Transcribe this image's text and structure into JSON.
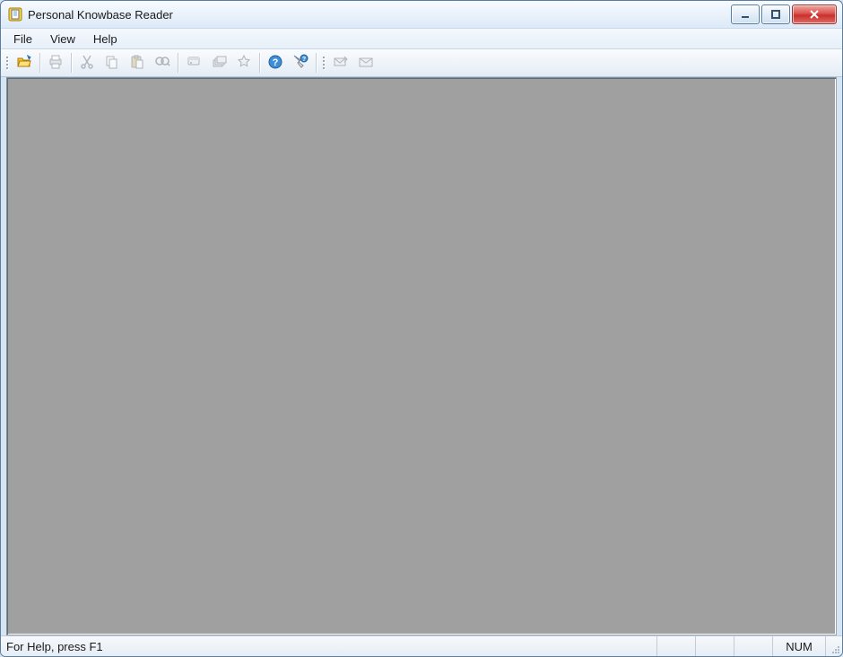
{
  "window": {
    "title": "Personal Knowbase Reader"
  },
  "menu": {
    "items": [
      {
        "label": "File"
      },
      {
        "label": "View"
      },
      {
        "label": "Help"
      }
    ]
  },
  "toolbar": {
    "groups": [
      {
        "items": [
          {
            "name": "open-icon",
            "enabled": true
          }
        ]
      },
      {
        "items": [
          {
            "name": "print-icon",
            "enabled": false
          }
        ]
      },
      {
        "items": [
          {
            "name": "cut-icon",
            "enabled": false
          },
          {
            "name": "copy-icon",
            "enabled": false
          },
          {
            "name": "paste-icon",
            "enabled": false
          },
          {
            "name": "find-icon",
            "enabled": false
          }
        ]
      },
      {
        "items": [
          {
            "name": "tag-icon",
            "enabled": false
          },
          {
            "name": "stack-icon",
            "enabled": false
          },
          {
            "name": "star-icon",
            "enabled": false
          }
        ]
      },
      {
        "items": [
          {
            "name": "help-icon",
            "enabled": true
          },
          {
            "name": "context-help-icon",
            "enabled": true
          }
        ]
      },
      {
        "items": [
          {
            "name": "mail-icon",
            "enabled": false
          },
          {
            "name": "envelope-icon",
            "enabled": false
          }
        ]
      }
    ]
  },
  "status": {
    "hint": "For Help, press F1",
    "numlock": "NUM"
  }
}
